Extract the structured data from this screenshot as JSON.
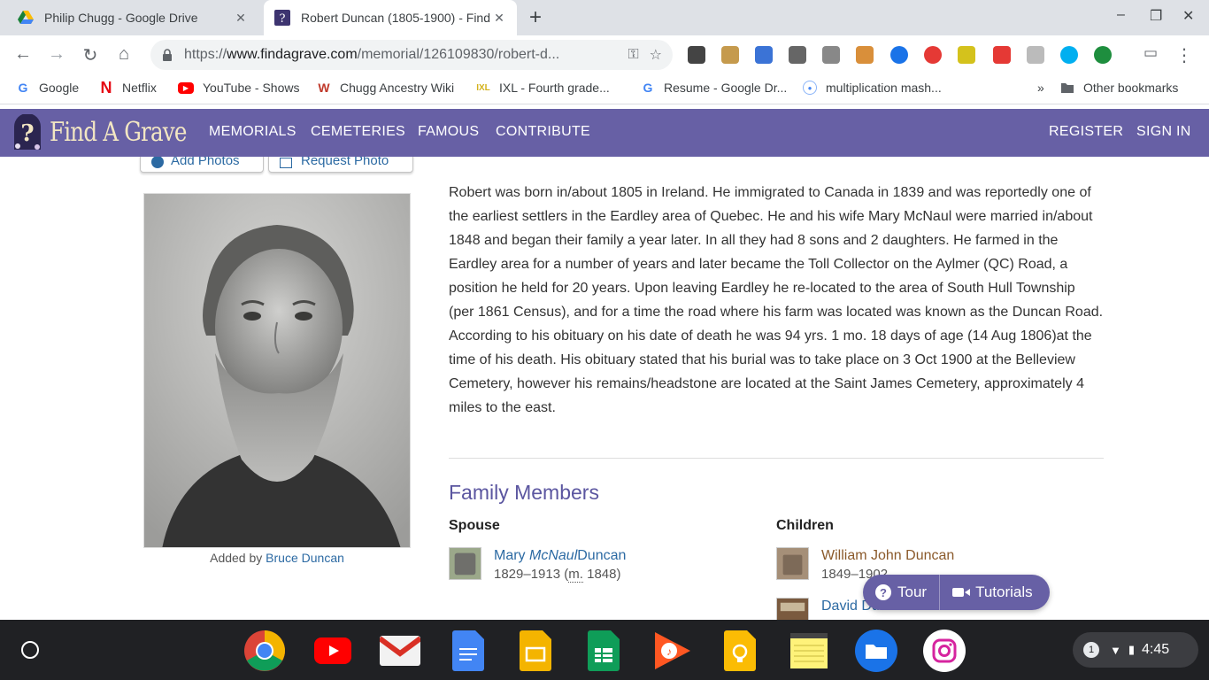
{
  "tabs": [
    {
      "title": "Philip Chugg - Google Drive",
      "active": false
    },
    {
      "title": "Robert Duncan (1805-1900) - Find a Grave Memorial",
      "active": true
    }
  ],
  "window_controls": {
    "minimize": "–",
    "maximize": "❐",
    "close": "✕"
  },
  "toolbar": {
    "url_prefix": "https://",
    "url_host": "www.findagrave.com",
    "url_path": "/memorial/126109830/robert-d..."
  },
  "bookmarks": [
    {
      "label": "Google",
      "icon": "google-icon"
    },
    {
      "label": "Netflix",
      "icon": "netflix-icon"
    },
    {
      "label": "YouTube - Shows",
      "icon": "youtube-icon"
    },
    {
      "label": "Chugg Ancestry Wiki",
      "icon": "wiki-icon"
    },
    {
      "label": "IXL - Fourth grade...",
      "icon": "ixl-icon"
    },
    {
      "label": "Resume - Google Dr...",
      "icon": "google-icon"
    },
    {
      "label": "multiplication mash...",
      "icon": "globe-icon"
    }
  ],
  "bookmarks_overflow": "»",
  "other_bookmarks": "Other bookmarks",
  "site": {
    "logo_text": "Find A Grave",
    "nav": [
      "MEMORIALS",
      "CEMETERIES",
      "FAMOUS",
      "CONTRIBUTE"
    ],
    "auth": [
      "REGISTER",
      "SIGN IN"
    ]
  },
  "photo_buttons": [
    "Add Photos",
    "Request Photo"
  ],
  "added_by": {
    "prefix": "Added by",
    "name": "Bruce Duncan"
  },
  "bio": "Robert was born in/about 1805 in Ireland. He immigrated to Canada in 1839 and was reportedly one of the earliest settlers in the Eardley area of Quebec. He and his wife Mary McNaul were married in/about 1848 and began their family a year later. In all they had 8 sons and 2 daughters. He farmed in the Eardley area for a number of years and later became the Toll Collector on the Aylmer (QC) Road, a position he held for 20 years. Upon leaving Eardley he re-located to the area of South Hull Township (per 1861 Census), and for a time the road where his farm was located was known as the Duncan Road. According to his obituary on his date of death he was 94 yrs. 1 mo. 18 days of age (14 Aug 1806)at the time of his death. His obituary stated that his burial was to take place on 3 Oct 1900 at the Belleview Cemetery, however his remains/headstone are located at the Saint James Cemetery, approximately 4 miles to the east.",
  "family": {
    "heading": "Family Members",
    "spouse_label": "Spouse",
    "children_label": "Children",
    "spouse": {
      "first": "Mary",
      "maiden": "McNaul",
      "last": "Duncan",
      "years": "1829–1913",
      "marriage_prefix": "(",
      "marriage_abbrev": "m.",
      "marriage_year": "1848)"
    },
    "children": [
      {
        "name": "William John Duncan",
        "years": "1849–1902"
      },
      {
        "name": "David Duncan",
        "years": ""
      }
    ]
  },
  "help_pill": {
    "tour": "Tour",
    "tutorials": "Tutorials"
  },
  "shelf": {
    "apps": [
      "chrome-icon",
      "youtube-icon",
      "gmail-icon",
      "docs-icon",
      "slides-icon",
      "sheets-icon",
      "play-music-icon",
      "keep-icon",
      "notepad-icon",
      "files-icon",
      "instagram-icon"
    ],
    "notification_count": "1",
    "time": "4:45"
  },
  "colors": {
    "site_nav": "#6760a5",
    "link": "#2c6aa3",
    "heading": "#5b56a0",
    "child_link": "#8b5a2b"
  }
}
